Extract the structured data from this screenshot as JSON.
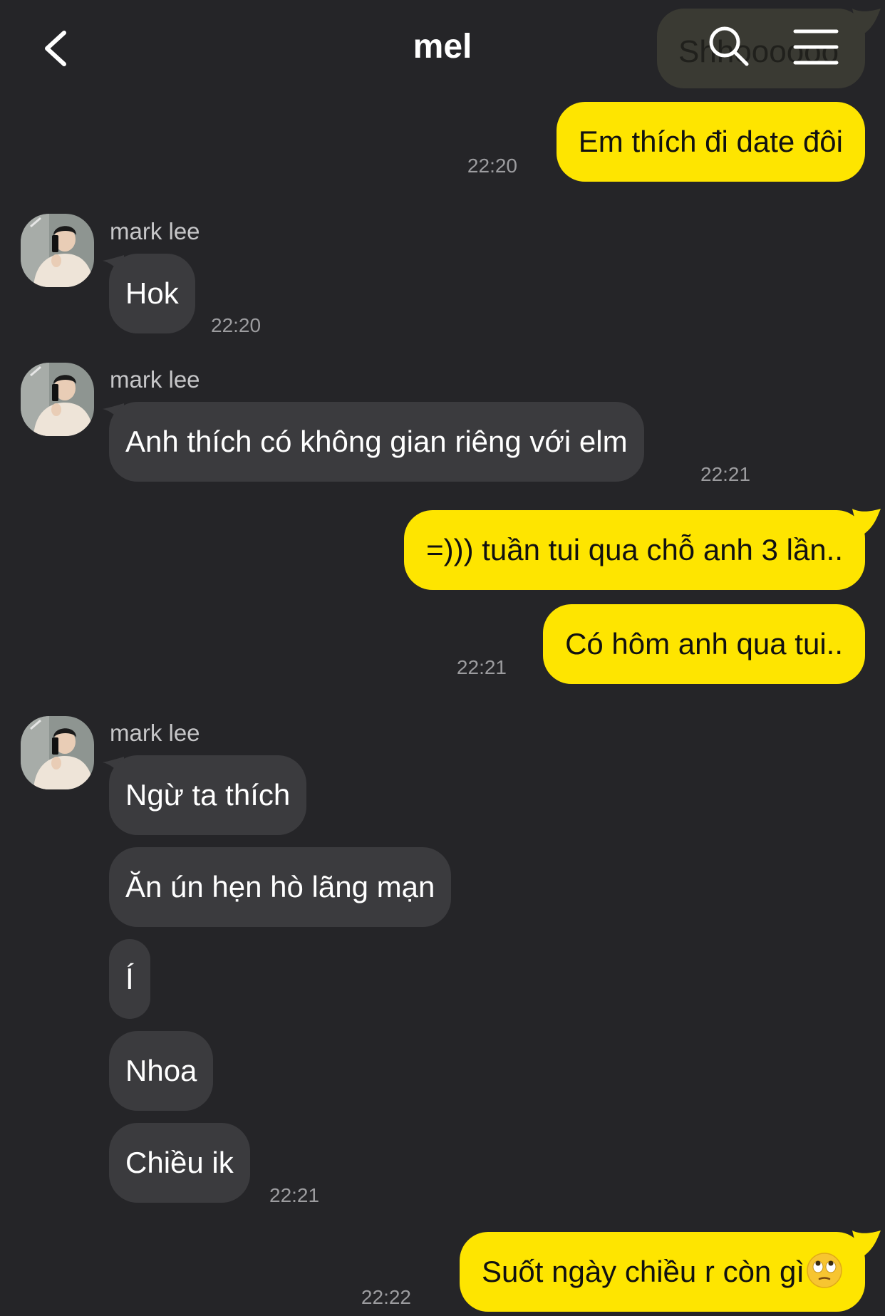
{
  "header": {
    "title": "mel",
    "back_icon": "chevron-left-icon",
    "search_icon": "search-icon",
    "menu_icon": "hamburger-menu-icon",
    "ghost_preview_text": "Shhoooooo"
  },
  "colors": {
    "background": "#252528",
    "outgoing_bubble": "#fee500",
    "incoming_bubble": "#3b3b3e",
    "timestamp": "#9c9c9f"
  },
  "messages": {
    "m1": {
      "text": "Em thích đi date đôi",
      "time": "22:20"
    },
    "g1": {
      "sender": "mark lee",
      "m1": {
        "text": "Hok"
      },
      "time": "22:20"
    },
    "g2": {
      "sender": "mark lee",
      "m1": {
        "text": "Anh thích có không gian riêng với elm"
      },
      "time": "22:21"
    },
    "m2": {
      "text": "=))) tuần tui qua chỗ anh 3 lần.."
    },
    "m3": {
      "text": "Có hôm anh qua tui..",
      "time": "22:21"
    },
    "g3": {
      "sender": "mark lee",
      "m1": {
        "text": "Ngừ ta thích"
      },
      "m2": {
        "text": "Ăn ún hẹn hò lãng mạn"
      },
      "m3": {
        "text": "Í"
      },
      "m4": {
        "text": "Nhoa"
      },
      "m5": {
        "text": "Chiều ik"
      },
      "time": "22:21"
    },
    "m4": {
      "text": "Suốt ngày chiều r còn gì",
      "emoji": "eye-roll-emoji",
      "time": "22:22"
    }
  }
}
